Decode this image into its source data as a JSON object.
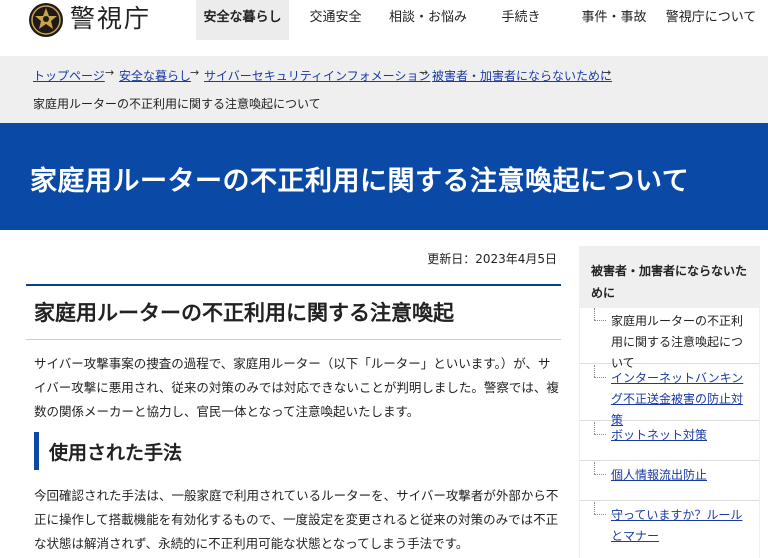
{
  "header": {
    "site_name": "警視庁",
    "nav": [
      "安全な暮らし",
      "交通安全",
      "相談・お悩み",
      "手続き",
      "事件・事故",
      "警視庁について"
    ],
    "active_nav": 0
  },
  "breadcrumb": {
    "items": [
      "トップページ",
      "安全な暮らし",
      "サイバーセキュリティインフォメーション",
      "被害者・加害者にならないために"
    ],
    "current": "家庭用ルーターの不正利用に関する注意喚起について"
  },
  "banner": {
    "title": "家庭用ルーターの不正利用に関する注意喚起について"
  },
  "main": {
    "updated": "更新日：2023年4月5日",
    "heading": "家庭用ルーターの不正利用に関する注意喚起",
    "intro": "サイバー攻撃事案の捜査の過程で、家庭用ルーター（以下「ルーター」といいます。）が、サイバー攻撃に悪用され、従来の対策のみでは対応できないことが判明しました。警察では、複数の関係メーカーと協力し、官民一体となって注意喚起いたします。",
    "section_heading": "使用された手法",
    "section_text": "今回確認された手法は、一般家庭で利用されているルーターを、サイバー攻撃者が外部から不正に操作して搭載機能を有効化するもので、一度設定を変更されると従来の対策のみでは不正な状態は解消されず、永続的に不正利用可能な状態となってしまう手法です。"
  },
  "sidebar": {
    "heading": "被害者・加害者にならないために",
    "items": [
      "家庭用ルーターの不正利用に関する注意喚起について",
      "インターネットバンキング不正送金被害の防止対策",
      "ボットネット対策",
      "個人情報流出防止",
      "守っていますか？ルールとマナー"
    ]
  },
  "colors": {
    "banner": "#0a49a6",
    "link": "#1a3aa5",
    "accent": "#0a3f8f"
  }
}
